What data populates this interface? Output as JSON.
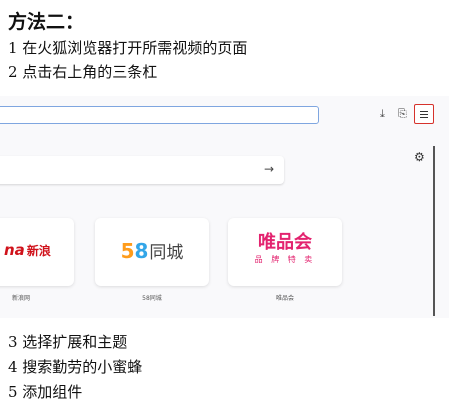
{
  "heading": "方法二：",
  "steps_top": [
    "1 在火狐浏览器打开所需视频的页面",
    "2 点击右上角的三条杠"
  ],
  "screenshot": {
    "toolbar_icons": {
      "download": "download-icon",
      "share": "share-icon",
      "menu": "hamburger-menu-icon"
    },
    "menu_button_highlight_color": "#d6322c",
    "search_arrow": "→",
    "shortcuts": [
      {
        "logo_main": "na",
        "logo_sub": "新浪",
        "label": "新浪网"
      },
      {
        "logo_5": "5",
        "logo_8": "8",
        "logo_text": "同城",
        "label": "58同城"
      },
      {
        "logo_main": "唯品会",
        "logo_sub": "品 牌 特 卖",
        "label": "唯品会"
      }
    ]
  },
  "steps_bottom": [
    "3 选择扩展和主题",
    "4 搜索勤劳的小蜜蜂",
    "5 添加组件"
  ]
}
